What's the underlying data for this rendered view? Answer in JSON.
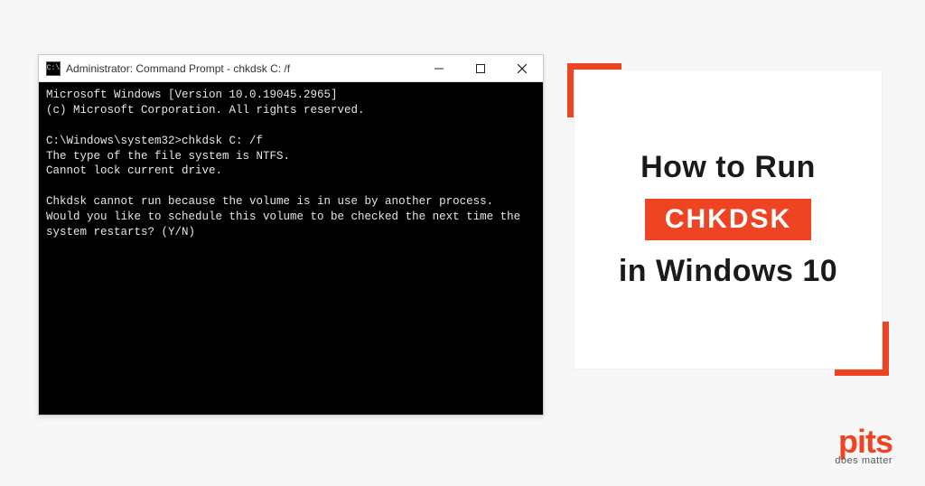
{
  "window": {
    "icon_text": "C:\\",
    "title": "Administrator: Command Prompt - chkdsk  C: /f",
    "buttons": {
      "minimize": "minimize",
      "maximize": "maximize",
      "close": "close"
    }
  },
  "terminal": {
    "line1": "Microsoft Windows [Version 10.0.19045.2965]",
    "line2": "(c) Microsoft Corporation. All rights reserved.",
    "line3": "C:\\Windows\\system32>chkdsk C: /f",
    "line4": "The type of the file system is NTFS.",
    "line5": "Cannot lock current drive.",
    "line6": "Chkdsk cannot run because the volume is in use by another process.  Would you like to schedule this volume to be checked the next time the system restarts? (Y/N)"
  },
  "card": {
    "line_top": "How to Run",
    "highlight": "CHKDSK",
    "line_bottom": "in Windows 10"
  },
  "logo": {
    "brand": "pits",
    "tagline": "does matter"
  },
  "colors": {
    "accent": "#ef4423",
    "terminal_bg": "#000000",
    "terminal_fg": "#e6e6e6",
    "page_bg": "#f7f7f7"
  }
}
